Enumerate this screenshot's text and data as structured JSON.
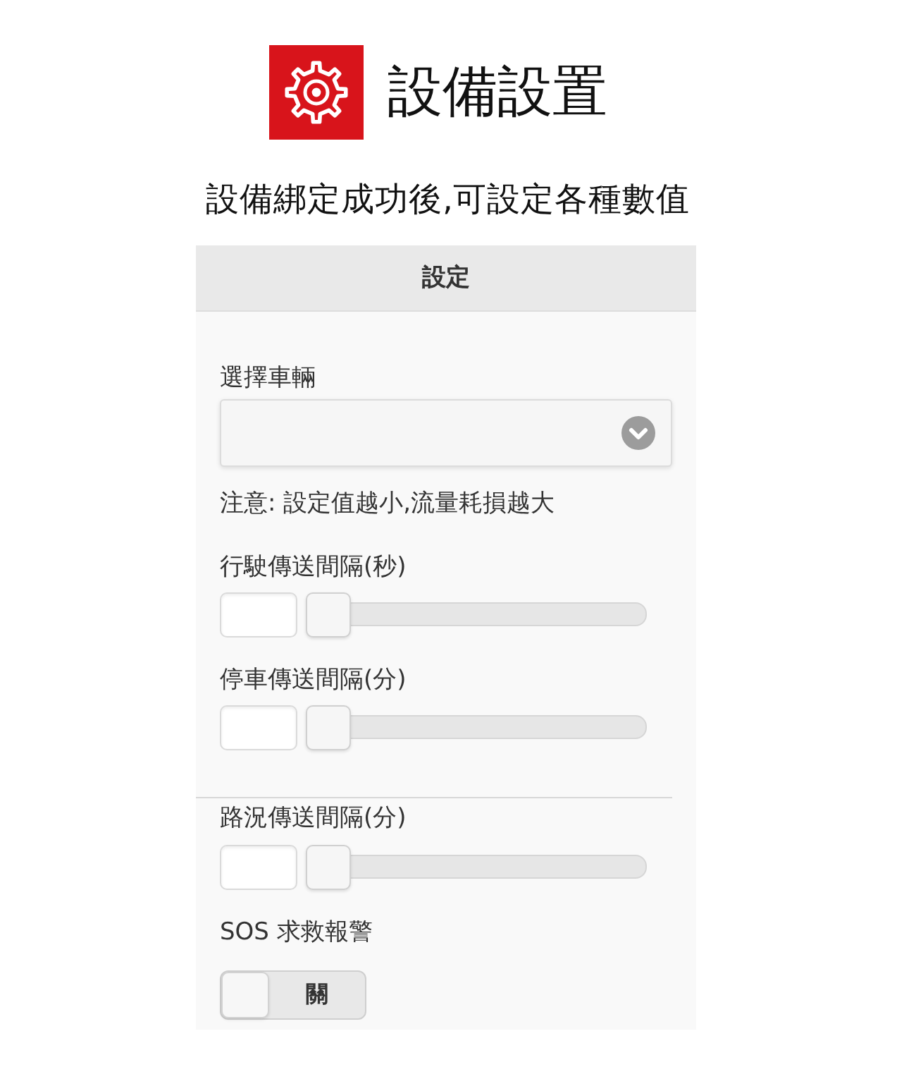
{
  "header": {
    "title": "設備設置"
  },
  "subtitle": "設備綁定成功後,可設定各種數值",
  "panel": {
    "title": "設定",
    "vehicle_select": {
      "label": "選擇車輛"
    },
    "note": "注意: 設定值越小,流量耗損越大",
    "sliders": [
      {
        "label": "行駛傳送間隔(秒)",
        "level": 0,
        "divider_before": false
      },
      {
        "label": "停車傳送間隔(分)",
        "level": 0,
        "divider_before": false
      },
      {
        "label": "路況傳送間隔(分)",
        "level": 0,
        "divider_before": true
      }
    ],
    "sos": {
      "label": "SOS 求救報警",
      "switch": {
        "on": false,
        "text": "關"
      }
    }
  }
}
